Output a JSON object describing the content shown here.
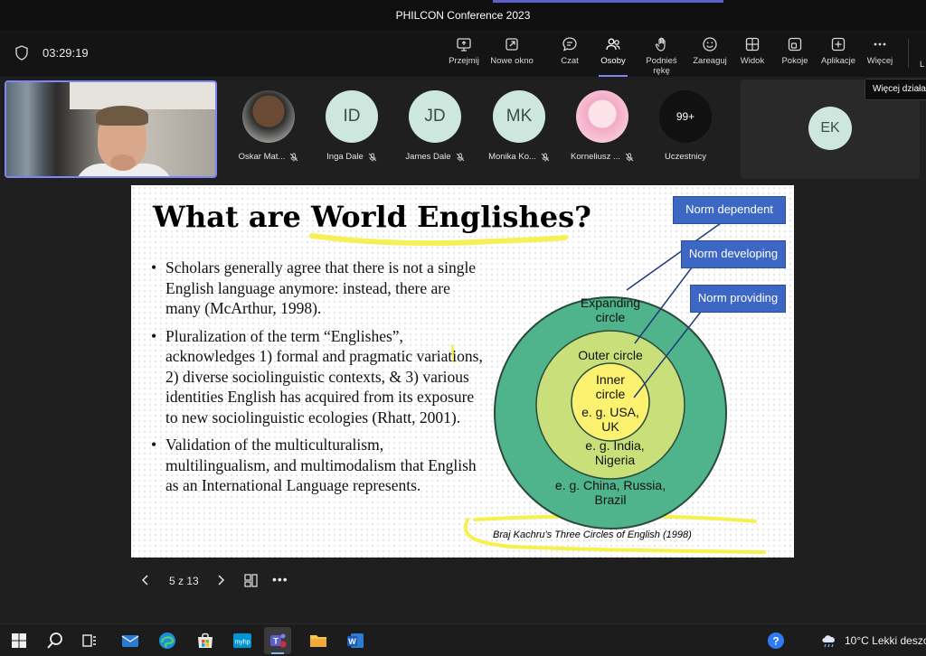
{
  "window": {
    "title": "PHILCON Conference 2023"
  },
  "toolbar": {
    "timer": "03:29:19",
    "buttons": [
      {
        "label": "Przejmij",
        "icon": "share-screen-icon"
      },
      {
        "label": "Nowe okno",
        "icon": "new-window-icon"
      },
      {
        "label": "Czat",
        "icon": "chat-icon"
      },
      {
        "label": "Osoby",
        "icon": "people-icon",
        "active": true
      },
      {
        "label": "Podnieś rękę",
        "icon": "raise-hand-icon"
      },
      {
        "label": "Zareaguj",
        "icon": "react-icon"
      },
      {
        "label": "Widok",
        "icon": "view-icon"
      },
      {
        "label": "Pokoje",
        "icon": "rooms-icon"
      },
      {
        "label": "Aplikacje",
        "icon": "apps-icon"
      },
      {
        "label": "Więcej",
        "icon": "more-icon"
      }
    ],
    "cut_label": "L",
    "tooltip": "Więcej działań"
  },
  "participants": [
    {
      "name": "Oskar Mat...",
      "initials": ""
    },
    {
      "name": "Inga Dale",
      "initials": "ID"
    },
    {
      "name": "James Dale",
      "initials": "JD"
    },
    {
      "name": "Monika Ko...",
      "initials": "MK"
    },
    {
      "name": "Korneliusz ...",
      "initials": ""
    },
    {
      "name": "Uczestnicy",
      "initials": "99+"
    }
  ],
  "ek_tile": {
    "initials": "EK"
  },
  "slide": {
    "title": "What are World Englishes?",
    "bullets": [
      "Scholars generally agree that there is not a single English language anymore: instead, there are many (McArthur, 1998).",
      "Pluralization of the term “Englishes”, acknowledges 1) formal and pragmatic variations, 2) diverse sociolinguistic contexts, & 3) various identities English has acquired from its exposure to new sociolinguistic ecologies (Rhatt, 2001).",
      "Validation of the multiculturalism, multilingualism, and multimodalism that English as an International Language represents."
    ],
    "norm_boxes": [
      "Norm dependent",
      "Norm developing",
      "Norm providing"
    ],
    "circles": {
      "expanding_title": [
        "Expanding",
        "circle"
      ],
      "expanding_example": [
        "e. g. China, Russia,",
        "Brazil"
      ],
      "outer_title": "Outer circle",
      "outer_example": [
        "e. g. India,",
        "Nigeria"
      ],
      "inner_title": [
        "Inner",
        "circle"
      ],
      "inner_example": [
        "e. g. USA,",
        "UK"
      ]
    },
    "caption": "Braj Kachru's Three Circles of English (1998)",
    "colors": {
      "expanding": "#4fb48c",
      "outer": "#c9e07a",
      "inner": "#fdf270",
      "norm_box": "#3c67c4",
      "highlight": "#f5ef3a"
    }
  },
  "presentation_nav": {
    "page": "5 z 13",
    "more": "•••"
  },
  "taskbar": {
    "weather": "10°C  Lekki deszc",
    "apps": [
      "windows-start-icon",
      "search-icon",
      "task-view-icon",
      "mail-icon",
      "edge-icon",
      "store-icon",
      "myhp-icon",
      "teams-icon",
      "file-explorer-icon",
      "word-icon"
    ]
  },
  "colors": {
    "accent": "#7f85f5",
    "toolbar_bg": "#141414",
    "stage_bg": "#1f1f1f"
  }
}
